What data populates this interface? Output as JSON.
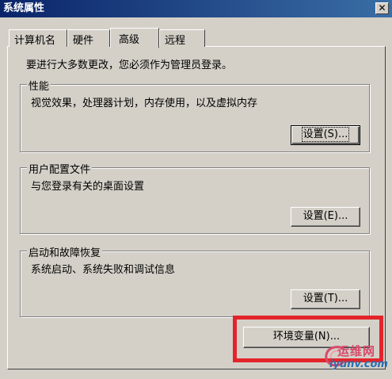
{
  "window": {
    "title": "系统属性",
    "close_glyph": "✕"
  },
  "tabs": [
    {
      "label": "计算机名"
    },
    {
      "label": "硬件"
    },
    {
      "label": "高级",
      "active": true
    },
    {
      "label": "远程"
    }
  ],
  "admin_note": "要进行大多数更改，您必须作为管理员登录。",
  "groups": {
    "performance": {
      "title": "性能",
      "desc": "视觉效果，处理器计划，内存使用，以及虚拟内存",
      "button": "设置(S)..."
    },
    "user_profiles": {
      "title": "用户配置文件",
      "desc": "与您登录有关的桌面设置",
      "button": "设置(E)..."
    },
    "startup_recovery": {
      "title": "启动和故障恢复",
      "desc": "系统启动、系统失败和调试信息",
      "button": "设置(T)..."
    }
  },
  "env_button": "环境变量(N)...",
  "highlight_color": "#e3242b",
  "watermark": {
    "cn": "运维网",
    "en": "iyunv.com"
  }
}
